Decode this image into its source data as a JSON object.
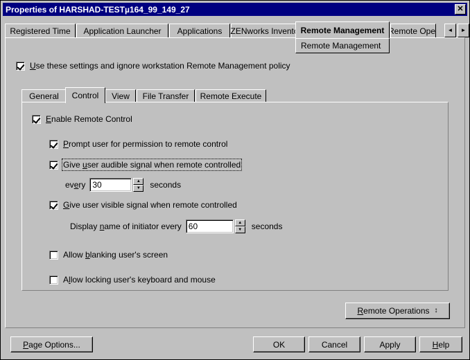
{
  "window": {
    "title": "Properties of HARSHAD-TESTµ164_99_149_27",
    "close_label": "✕"
  },
  "outer_tabs": {
    "items": [
      {
        "label": "Registered Time",
        "active": false
      },
      {
        "label": "Application Launcher",
        "active": false
      },
      {
        "label": "Applications",
        "active": false
      },
      {
        "label": "ZENworks Inventory",
        "active": false,
        "has_dropdown": true,
        "dropdown_glyph": "▼"
      },
      {
        "label": "Remote Management",
        "active": true
      },
      {
        "label": "Remote Oper",
        "active": false,
        "clipped": true
      }
    ],
    "dropdown_menu": {
      "label": "Remote Management"
    },
    "scroll_left_glyph": "◄",
    "scroll_right_glyph": "►"
  },
  "policy_override": {
    "label_prefix": "",
    "accel": "U",
    "label_rest": "se these settings and ignore workstation Remote Management policy",
    "checked": true
  },
  "inner_tabs": {
    "items": [
      {
        "label": "General",
        "active": false
      },
      {
        "label": "Control",
        "active": true
      },
      {
        "label": "View",
        "active": false
      },
      {
        "label": "File Transfer",
        "active": false
      },
      {
        "label": "Remote Execute",
        "active": false
      }
    ]
  },
  "control_panel": {
    "enable_remote_control": {
      "prefix": "",
      "accel": "E",
      "rest": "nable Remote Control",
      "checked": true
    },
    "prompt_permission": {
      "prefix": "",
      "accel": "P",
      "rest": "rompt user for permission to remote control",
      "checked": true
    },
    "audible_signal": {
      "prefix": "Give ",
      "accel": "u",
      "rest": "ser audible signal when remote controlled",
      "checked": true,
      "focused": true
    },
    "audible_every": {
      "prefix": "ev",
      "accel": "e",
      "rest": "ry",
      "value": "30",
      "unit": "seconds"
    },
    "visible_signal": {
      "prefix": "",
      "accel": "G",
      "rest": "ive user visible signal when remote controlled",
      "checked": true
    },
    "display_name": {
      "prefix": "Display ",
      "accel": "n",
      "rest": "ame of initiator every",
      "value": "60",
      "unit": "seconds"
    },
    "allow_blanking": {
      "prefix": "Allow ",
      "accel": "b",
      "rest": "lanking user's screen",
      "checked": false
    },
    "allow_locking": {
      "prefix": "A",
      "accel": "l",
      "rest": "low locking user's keyboard and mouse",
      "checked": false
    }
  },
  "remote_operations_button": {
    "prefix": "",
    "accel": "R",
    "rest": "emote Operations",
    "glyph": "↕"
  },
  "footer": {
    "page_options": {
      "prefix": "",
      "accel": "P",
      "rest": "age Options..."
    },
    "ok": "OK",
    "cancel": "Cancel",
    "apply": "Apply",
    "help": {
      "prefix": "",
      "accel": "H",
      "rest": "elp"
    }
  },
  "colors": {
    "titlebar": "#000080",
    "face": "#c0c0c0",
    "field": "#ffffff"
  }
}
